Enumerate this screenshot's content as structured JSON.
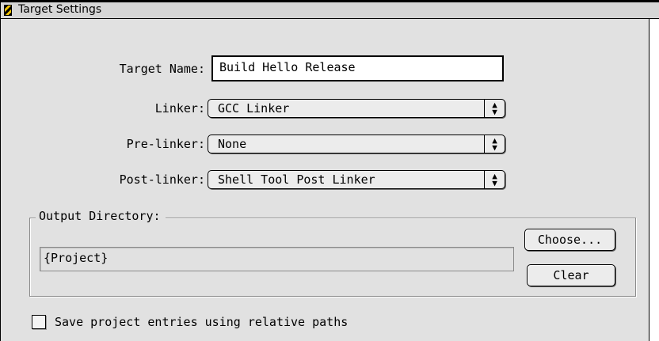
{
  "window": {
    "title": "Target Settings",
    "icon": "stripe-warning-icon"
  },
  "form": {
    "target_name_label": "Target Name:",
    "target_name_value": "Build Hello Release",
    "linker_label": "Linker:",
    "linker_value": "GCC Linker",
    "prelinker_label": "Pre-linker:",
    "prelinker_value": "None",
    "postlinker_label": "Post-linker:",
    "postlinker_value": "Shell Tool Post Linker"
  },
  "output_directory": {
    "group_label": "Output Directory:",
    "path_value": "{Project}",
    "choose_label": "Choose...",
    "clear_label": "Clear"
  },
  "options": {
    "relative_paths_label": "Save project entries using relative paths",
    "relative_paths_checked": false
  },
  "icons": {
    "popup_arrows": "up-down-arrows-icon"
  }
}
